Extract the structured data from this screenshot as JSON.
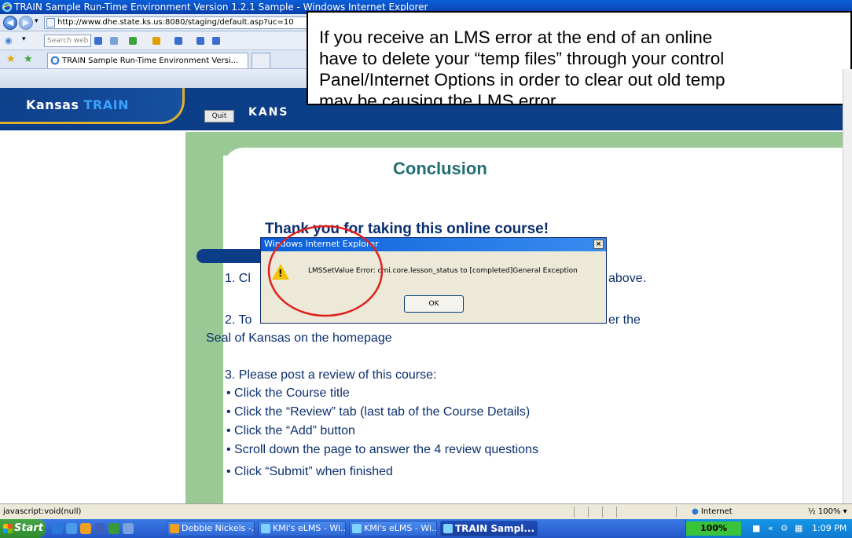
{
  "window": {
    "title": "TRAIN Sample Run-Time Environment Version 1.2.1 Sample - Windows Internet Explorer",
    "address": "http://www.dhe.state.ks.us:8080/staging/default.asp?uc=10",
    "search_placeholder": "Search web",
    "tab_label": "TRAIN Sample Run-Time Environment Versi..."
  },
  "header": {
    "logo_prefix": "Kansas ",
    "logo_train": "TRAIN",
    "quit_label": "Quit",
    "kansas_label": "KANS"
  },
  "callout": {
    "line1": "If you receive an LMS error at the end of an online",
    "line2": "have to delete your “temp files” through your control",
    "line3": "Panel/Internet Options in order to clear out old temp",
    "line4": "may be causing the LMS error."
  },
  "content": {
    "heading": "Conclusion",
    "thanks": "Thank you for taking this online course!",
    "step1_start": "1. Cl",
    "step1_end": "above.",
    "step2_start": "2. To",
    "step2_end": "er the",
    "step2_line2": "Seal of Kansas on the homepage",
    "step3_title": "3. Please post a review of this course:",
    "bullets": [
      "•  Click the Course title",
      "•  Click the “Review” tab (last tab of the Course Details)",
      "•  Click the “Add” button",
      "•  Scroll down the page to answer the 4 review questions",
      "•  Click “Submit” when finished"
    ]
  },
  "dialog": {
    "title": "Windows Internet Explorer",
    "close": "×",
    "message": "LMSSetValue Error: cmi.core.lesson_status to [completed]General Exception",
    "ok_label": "OK"
  },
  "statusbar": {
    "text": "javascript:void(null)",
    "zone": "Internet",
    "zoom": "½ 100%  ▾"
  },
  "taskbar": {
    "start_label": "Start",
    "tasks": [
      "Debbie Nickels -...",
      "KMi's eLMS - Wi...",
      "KMi's eLMS - Wi...",
      "TRAIN Sampl..."
    ],
    "zoom_badge": "100%",
    "clock": "1:09 PM"
  },
  "colors": {
    "ie_blue": "#0a5fd8",
    "navy": "#0b3e86",
    "green": "#9bc995",
    "heading_teal": "#226e72",
    "body_navy": "#0b2f6e",
    "annotation_red": "#e0201e"
  }
}
